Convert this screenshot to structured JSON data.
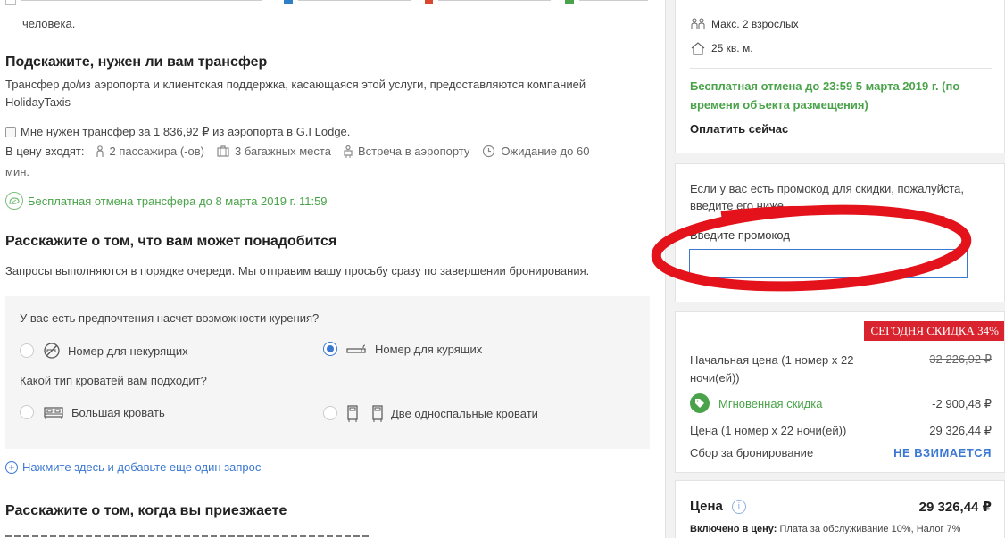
{
  "left": {
    "top_partial": "человека.",
    "transfer": {
      "title": "Подскажите, нужен ли вам трансфер",
      "desc_line1": "Трансфер до/из аэропорта и клиентская поддержка, касающаяся этой услуги, предоставляются компанией",
      "desc_line2": "HolidayTaxis",
      "checkbox_label": "Мне нужен трансфер за 1 836,92 ₽ из аэропорта в G.I Lodge.",
      "includes_label": "В цену входят:",
      "includes": [
        {
          "icon": "person-icon",
          "text": "2 пассажира (-ов)"
        },
        {
          "icon": "luggage-icon",
          "text": "3 багажных места"
        },
        {
          "icon": "greeter-icon",
          "text": "Встреча в аэропорту"
        },
        {
          "icon": "clock-icon",
          "text": "Ожидание до 60"
        }
      ],
      "includes_wrap": "мин.",
      "free_cancel": "Бесплатная отмена трансфера до 8 марта 2019 г. 11:59"
    },
    "requests": {
      "title": "Расскажите о том, что вам может понадобится",
      "desc": "Запросы выполняются в порядке очереди. Мы отправим вашу просьбу сразу по завершении бронирования.",
      "smoking_question": "У вас есть предпочтения насчет возможности курения?",
      "smoking_options": [
        "Номер для некурящих",
        "Номер для курящих"
      ],
      "smoking_selected": 1,
      "bed_question": "Какой тип кроватей вам подходит?",
      "bed_options": [
        "Большая кровать",
        "Две односпальные кровати"
      ],
      "add_request": "Нажмите здесь и добавьте еще один запрос"
    },
    "arrival": {
      "title": "Расскажите о том, когда вы приезжаете"
    }
  },
  "right": {
    "room": {
      "max_guests": "Макс. 2 взрослых",
      "area": "25 кв. м.",
      "free_cancel": "Бесплатная отмена до 23:59 5 марта 2019 г. (по времени объекта размещения)",
      "pay_now": "Оплатить сейчас"
    },
    "promo": {
      "text_line1": "Если у вас есть промокод для скидки, пожалуйста,",
      "text_line2": "введите его ниже",
      "label": "Введите промокод",
      "value": ""
    },
    "price": {
      "badge": "СЕГОДНЯ СКИДКА 34%",
      "rows": [
        {
          "label": "Начальная цена (1 номер x 22 ночи(ей))",
          "value": "32 226,92 ₽"
        },
        {
          "label": "Мгновенная скидка",
          "value": "-2 900,48 ₽"
        },
        {
          "label": "Цена (1 номер x 22 ночи(ей))",
          "value": "29 326,44 ₽"
        },
        {
          "label": "Сбор за бронирование",
          "value": "НЕ ВЗИМАЕТСЯ"
        }
      ]
    },
    "total": {
      "label": "Цена",
      "value": "29 326,44 ₽",
      "included_label": "Включено в цену:",
      "included_text": "Плата за обслуживание 10%, Налог 7%"
    }
  },
  "colors": {
    "accent_blue": "#3b78d1",
    "green": "#4aa34a",
    "badge_red": "#d9232e",
    "annotation_red": "#e3121b"
  }
}
